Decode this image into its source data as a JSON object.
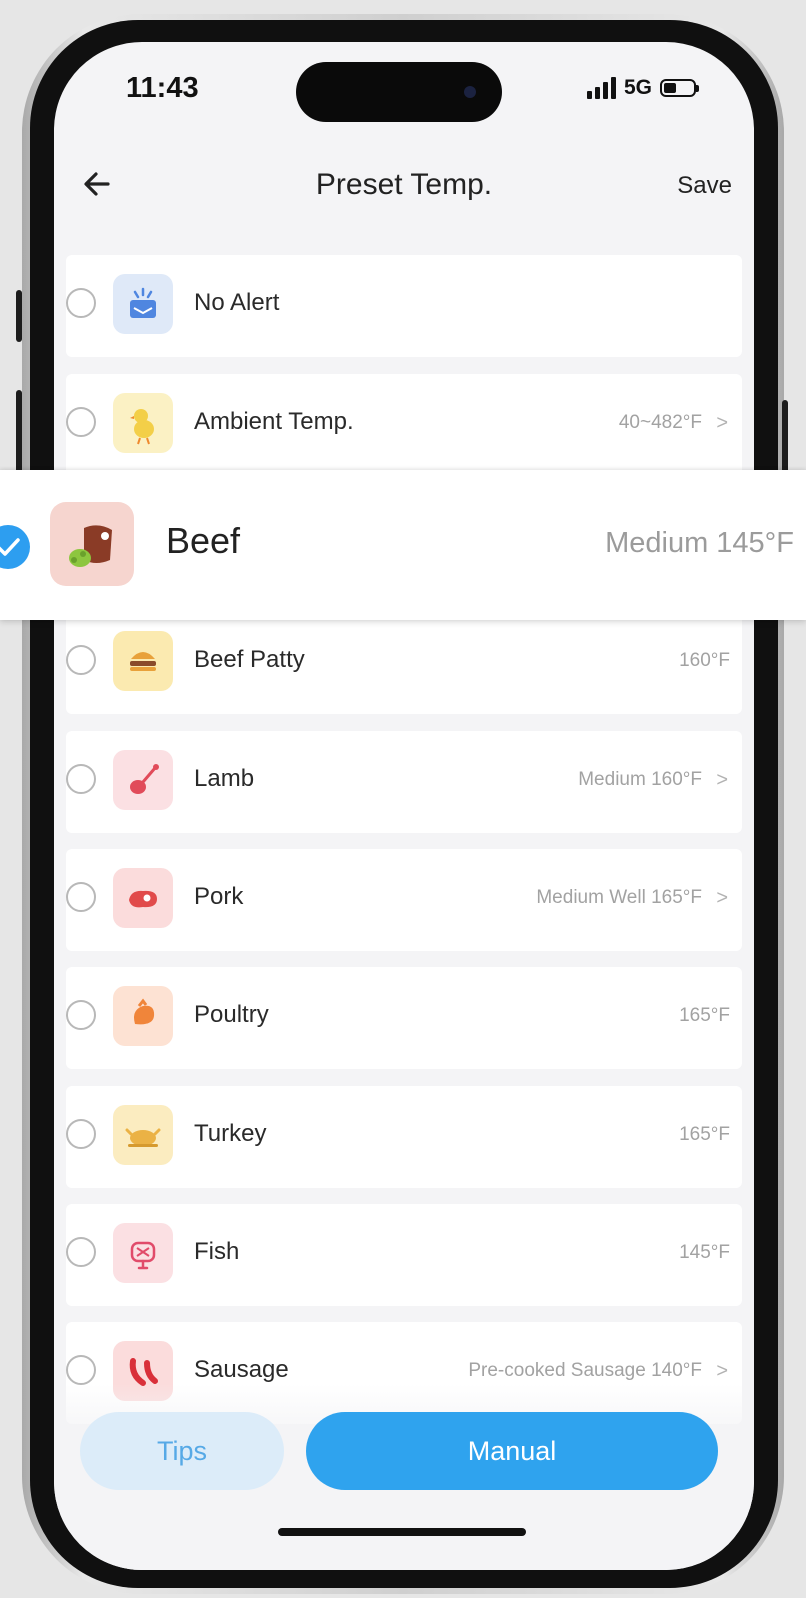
{
  "status_bar": {
    "time": "11:43",
    "network": "5G"
  },
  "nav": {
    "title": "Preset Temp.",
    "save_label": "Save",
    "back_icon": "arrow-left-icon"
  },
  "items": [
    {
      "label": "No Alert",
      "value": "",
      "has_chevron": false,
      "icon": "alarm-icon",
      "icon_bg": "#dfe9f8",
      "selected": false
    },
    {
      "label": "Ambient Temp.",
      "value": "40~482°F",
      "has_chevron": true,
      "icon": "chick-icon",
      "icon_bg": "#fbf1c4",
      "selected": false
    },
    {
      "label": "Beef",
      "value": "Medium 145°F",
      "has_chevron": false,
      "icon": "beef-icon",
      "icon_bg": "#f6d5cf",
      "selected": true
    },
    {
      "label": "Beef Patty",
      "value": "160°F",
      "has_chevron": false,
      "icon": "burger-icon",
      "icon_bg": "#fbeab0",
      "selected": false
    },
    {
      "label": "Lamb",
      "value": "Medium 160°F",
      "has_chevron": true,
      "icon": "lamb-chop-icon",
      "icon_bg": "#fbe0e3",
      "selected": false
    },
    {
      "label": "Pork",
      "value": "Medium Well 165°F",
      "has_chevron": true,
      "icon": "pork-icon",
      "icon_bg": "#fbdcdc",
      "selected": false
    },
    {
      "label": "Poultry",
      "value": "165°F",
      "has_chevron": false,
      "icon": "drumstick-icon",
      "icon_bg": "#fde2d3",
      "selected": false
    },
    {
      "label": "Turkey",
      "value": "165°F",
      "has_chevron": false,
      "icon": "turkey-icon",
      "icon_bg": "#fbecc0",
      "selected": false
    },
    {
      "label": "Fish",
      "value": "145°F",
      "has_chevron": false,
      "icon": "fish-icon",
      "icon_bg": "#fbe0e3",
      "selected": false
    },
    {
      "label": "Sausage",
      "value": "Pre-cooked Sausage 140°F",
      "has_chevron": true,
      "icon": "sausage-icon",
      "icon_bg": "#fbdcdc",
      "selected": false
    }
  ],
  "buttons": {
    "tips_label": "Tips",
    "manual_label": "Manual"
  },
  "colors": {
    "accent": "#2fa3ee",
    "tips_bg": "#dcecf9",
    "tips_text": "#56a9e6"
  }
}
